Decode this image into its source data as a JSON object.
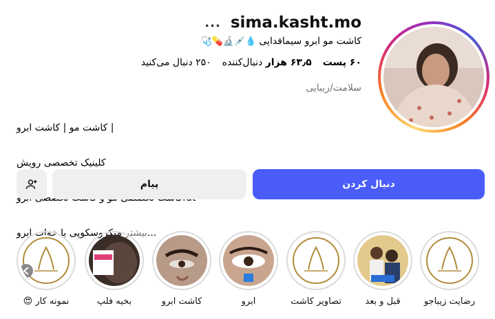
{
  "profile": {
    "username": "sima.kasht.mo",
    "more_icon": "...",
    "full_name": "کاشت مو ابرو سیمافدایی",
    "full_name_emojis": "💧💉🔬💊🩺",
    "stats": {
      "posts": "۶۰ پست",
      "followers_count": "۶۳٫۵ هزار",
      "followers_label": "دنبال‌کننده",
      "following": "۲۵۰ دنبال می‌کنید"
    },
    "category": "سلامت/زیبایی",
    "bio_lines": [
      "کاشت مو | کاشت ابرو |",
      "کلینیک تخصصی رویش",
      "کاشت تخصصی مو و کاشت تخصصی ابروfut",
      "میکروسکوپی با خواب ابرو..."
    ],
    "bio_more": "بیشتر"
  },
  "actions": {
    "follow_label": "دنبال کردن",
    "message_label": "پیام"
  },
  "highlights": [
    {
      "label": "رضایت زیباجو",
      "icon": "logo-hair-transplant"
    },
    {
      "label": "قبل و بعد",
      "icon": "before-after-photo"
    },
    {
      "label": "تصاویر کاشت",
      "icon": "logo-hair-transplant"
    },
    {
      "label": "ابرو",
      "icon": "eye-makeup-photo"
    },
    {
      "label": "کاشت ابرو",
      "icon": "eye-closeup-photo"
    },
    {
      "label": "بخیه فلپ",
      "icon": "scalp-photo"
    },
    {
      "label": "نمونه کار 😍",
      "icon": "logo-hair-transplant"
    }
  ],
  "colors": {
    "follow_button": "#4a5df9",
    "secondary_button": "#efefef",
    "muted_text": "#737373"
  }
}
